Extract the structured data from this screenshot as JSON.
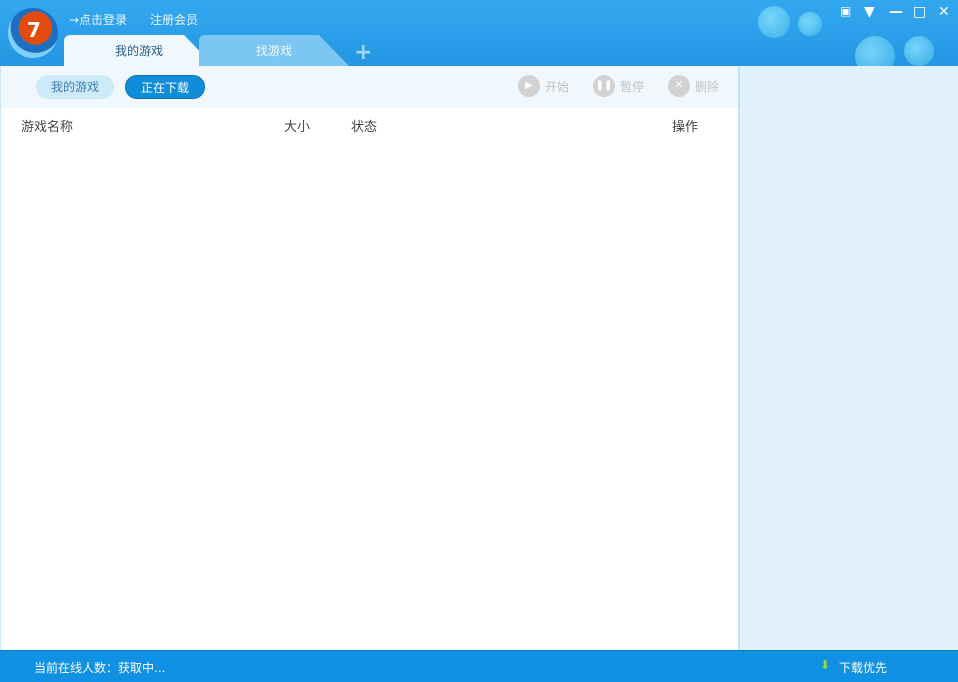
{
  "header": {
    "logo_text": "7",
    "login": "→点击登录",
    "register": "注册会员"
  },
  "tabs": [
    {
      "label": "我的游戏"
    },
    {
      "label": "找游戏"
    }
  ],
  "add_tab": "+",
  "window_controls": {
    "feedback": "feedback-icon",
    "menu": "menu-icon",
    "minimize": "—",
    "maximize": "□",
    "close": "✕"
  },
  "toolbar": {
    "my_games": "我的游戏",
    "downloading": "正在下载",
    "start": "开始",
    "pause": "暂停",
    "delete": "删除"
  },
  "columns": {
    "name": "游戏名称",
    "size": "大小",
    "status": "状态",
    "action": "操作"
  },
  "statusbar": {
    "online": "当前在线人数：获取中...",
    "download_priority": "下载优先"
  }
}
